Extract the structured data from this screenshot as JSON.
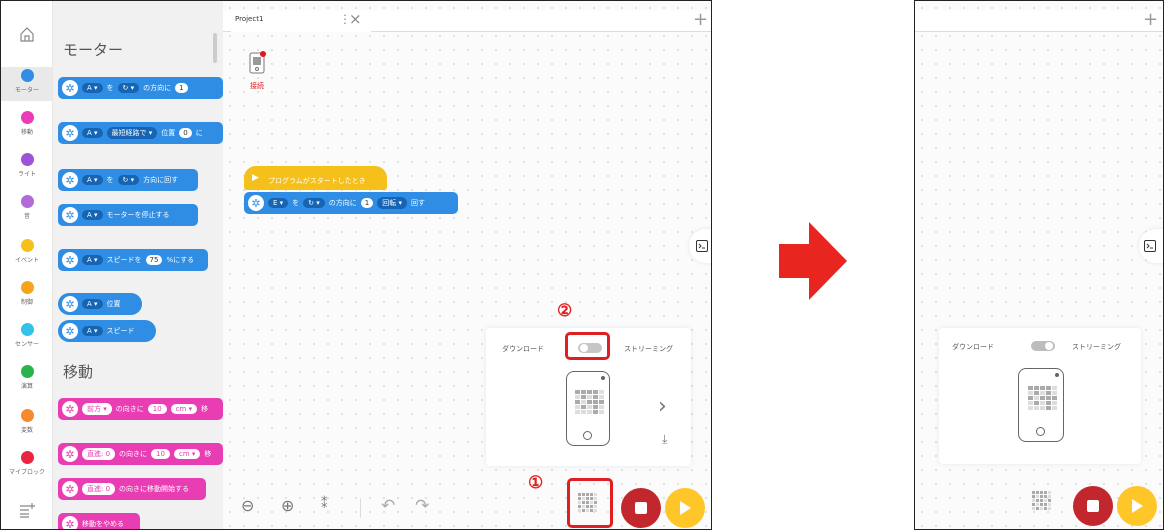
{
  "rail": {
    "items": [
      {
        "label": "モーター",
        "color": "#2f8de4"
      },
      {
        "label": "移動",
        "color": "#e93db4"
      },
      {
        "label": "ライト",
        "color": "#9e52d6"
      },
      {
        "label": "音",
        "color": "#b26ad6"
      },
      {
        "label": "イベント",
        "color": "#f5c01b"
      },
      {
        "label": "制御",
        "color": "#f7a41d"
      },
      {
        "label": "センサー",
        "color": "#35c2e8"
      },
      {
        "label": "演算",
        "color": "#29b34a"
      },
      {
        "label": "変数",
        "color": "#f58a2e"
      },
      {
        "label": "マイブロック",
        "color": "#e8263f"
      }
    ]
  },
  "palette": {
    "motor_title": "モーター",
    "move_title": "移動",
    "motor_blocks": [
      {
        "parts": [
          "A ▾",
          "を",
          "↻ ▾",
          "の方向に",
          "1"
        ]
      },
      {
        "parts": [
          "A ▾",
          "最短経路で ▾",
          "位置",
          "0",
          "に"
        ]
      },
      {
        "parts": [
          "A ▾",
          "を",
          "↻ ▾",
          "方向に回す"
        ]
      },
      {
        "parts": [
          "A ▾",
          "モーターを停止する"
        ]
      },
      {
        "parts": [
          "A ▾",
          "スピードを",
          "75",
          "%にする"
        ]
      },
      {
        "parts": [
          "A ▾",
          "位置"
        ]
      },
      {
        "parts": [
          "A ▾",
          "スピード"
        ]
      }
    ],
    "move_blocks": [
      {
        "parts": [
          "前方 ▾",
          "の向きに",
          "10",
          "cm ▾",
          "移"
        ]
      },
      {
        "parts": [
          "直進: 0",
          "の向きに",
          "10",
          "cm ▾",
          "移"
        ]
      },
      {
        "parts": [
          "直進: 0",
          "の向きに移動開始する"
        ]
      },
      {
        "parts": [
          "移動をやめる"
        ]
      }
    ]
  },
  "tab": {
    "title": "Project1"
  },
  "device_label": "接続",
  "script": {
    "hat": "プログラムがスタートしたとき",
    "parts": [
      "E ▾",
      "を",
      "↻ ▾",
      "の方向に",
      "1",
      "回転 ▾",
      "回す"
    ]
  },
  "stream_panel": {
    "download": "ダウンロード",
    "streaming": "ストリーミング"
  },
  "annotations": {
    "one": "①",
    "two": "②"
  },
  "colors": {
    "stop": "#c1272d",
    "play": "#ffc62a",
    "arrow": "#e8261f",
    "highlight": "#e02020"
  }
}
